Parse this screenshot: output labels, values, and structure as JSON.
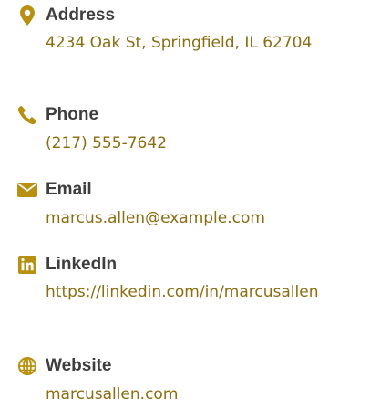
{
  "contact": {
    "accent_color": "#b8900f",
    "items": [
      {
        "icon": "map-pin-icon",
        "label": "Address",
        "value": "4234 Oak St, Springfield, IL 62704"
      },
      {
        "icon": "phone-icon",
        "label": "Phone",
        "value": "(217) 555-7642"
      },
      {
        "icon": "email-icon",
        "label": "Email",
        "value": "marcus.allen@example.com"
      },
      {
        "icon": "linkedin-icon",
        "label": "LinkedIn",
        "value": "https://linkedin.com/in/marcusallen"
      },
      {
        "icon": "globe-icon",
        "label": "Website",
        "value": "marcusallen.com"
      }
    ]
  }
}
